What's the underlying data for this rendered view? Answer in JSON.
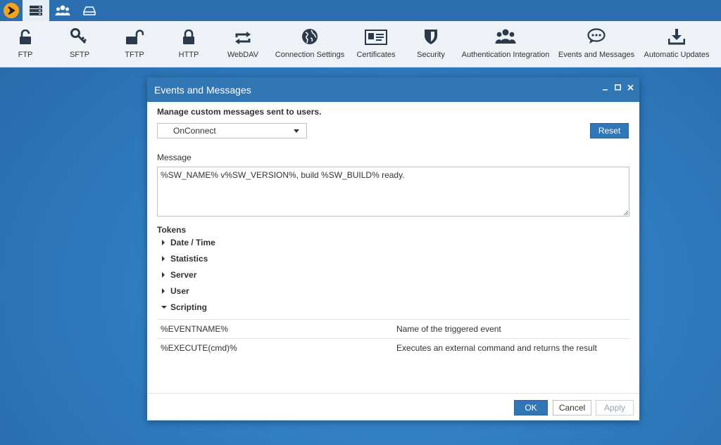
{
  "topbar": {
    "tabs": [
      {
        "icon": "server-list-icon",
        "active": true
      },
      {
        "icon": "users-icon",
        "active": false
      },
      {
        "icon": "drive-icon",
        "active": false
      }
    ]
  },
  "toolbar": {
    "items": [
      {
        "label": "FTP",
        "icon": "lock-open-icon"
      },
      {
        "label": "SFTP",
        "icon": "key-icon"
      },
      {
        "label": "TFTP",
        "icon": "lock-open-icon"
      },
      {
        "label": "HTTP",
        "icon": "lock-icon"
      },
      {
        "label": "WebDAV",
        "icon": "sync-icon"
      },
      {
        "label": "Connection Settings",
        "icon": "globe-icon"
      },
      {
        "label": "Certificates",
        "icon": "certificate-icon"
      },
      {
        "label": "Security",
        "icon": "shield-icon"
      },
      {
        "label": "Authentication Integration",
        "icon": "users-icon"
      },
      {
        "label": "Events and Messages",
        "icon": "chat-icon"
      },
      {
        "label": "Automatic Updates",
        "icon": "download-icon"
      }
    ]
  },
  "dialog": {
    "title": "Events and Messages",
    "intro": "Manage custom messages sent to users.",
    "event_select": "OnConnect",
    "reset_label": "Reset",
    "message_label": "Message",
    "message_value": "%SW_NAME% v%SW_VERSION%, build %SW_BUILD% ready.",
    "tokens_label": "Tokens",
    "token_groups": [
      {
        "label": "Date / Time",
        "expanded": false
      },
      {
        "label": "Statistics",
        "expanded": false
      },
      {
        "label": "Server",
        "expanded": false
      },
      {
        "label": "User",
        "expanded": false
      },
      {
        "label": "Scripting",
        "expanded": true
      }
    ],
    "scripting_tokens": [
      {
        "name": "%EVENTNAME%",
        "description": "Name of the triggered event"
      },
      {
        "name": "%EXECUTE(cmd)%",
        "description": "Executes an external command and returns the result"
      }
    ],
    "ok_label": "OK",
    "cancel_label": "Cancel",
    "apply_label": "Apply"
  },
  "colors": {
    "accent": "#3176b5",
    "topbar": "#2b6fb0",
    "toolbar_bg": "#eef2f6",
    "logo": "#f4a41c"
  }
}
